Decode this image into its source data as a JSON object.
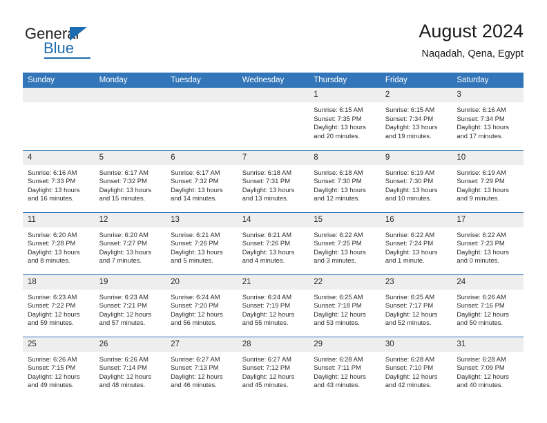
{
  "logo": {
    "name_top": "General",
    "name_bottom": "Blue",
    "accent_color": "#1b6cb0",
    "icon": "triangle-icon"
  },
  "header": {
    "title": "August 2024",
    "location": "Naqadah, Qena, Egypt"
  },
  "theme": {
    "header_blue": "#3275b8",
    "daynum_gray": "#eeeeee",
    "text": "#2b2b2b"
  },
  "calendar": {
    "weekday_headers": [
      "Sunday",
      "Monday",
      "Tuesday",
      "Wednesday",
      "Thursday",
      "Friday",
      "Saturday"
    ],
    "weeks": [
      [
        {
          "empty": true
        },
        {
          "empty": true
        },
        {
          "empty": true
        },
        {
          "empty": true
        },
        {
          "day": "1",
          "sunrise": "Sunrise: 6:15 AM",
          "sunset": "Sunset: 7:35 PM",
          "daylight": "Daylight: 13 hours and 20 minutes."
        },
        {
          "day": "2",
          "sunrise": "Sunrise: 6:15 AM",
          "sunset": "Sunset: 7:34 PM",
          "daylight": "Daylight: 13 hours and 19 minutes."
        },
        {
          "day": "3",
          "sunrise": "Sunrise: 6:16 AM",
          "sunset": "Sunset: 7:34 PM",
          "daylight": "Daylight: 13 hours and 17 minutes."
        }
      ],
      [
        {
          "day": "4",
          "sunrise": "Sunrise: 6:16 AM",
          "sunset": "Sunset: 7:33 PM",
          "daylight": "Daylight: 13 hours and 16 minutes."
        },
        {
          "day": "5",
          "sunrise": "Sunrise: 6:17 AM",
          "sunset": "Sunset: 7:32 PM",
          "daylight": "Daylight: 13 hours and 15 minutes."
        },
        {
          "day": "6",
          "sunrise": "Sunrise: 6:17 AM",
          "sunset": "Sunset: 7:32 PM",
          "daylight": "Daylight: 13 hours and 14 minutes."
        },
        {
          "day": "7",
          "sunrise": "Sunrise: 6:18 AM",
          "sunset": "Sunset: 7:31 PM",
          "daylight": "Daylight: 13 hours and 13 minutes."
        },
        {
          "day": "8",
          "sunrise": "Sunrise: 6:18 AM",
          "sunset": "Sunset: 7:30 PM",
          "daylight": "Daylight: 13 hours and 12 minutes."
        },
        {
          "day": "9",
          "sunrise": "Sunrise: 6:19 AM",
          "sunset": "Sunset: 7:30 PM",
          "daylight": "Daylight: 13 hours and 10 minutes."
        },
        {
          "day": "10",
          "sunrise": "Sunrise: 6:19 AM",
          "sunset": "Sunset: 7:29 PM",
          "daylight": "Daylight: 13 hours and 9 minutes."
        }
      ],
      [
        {
          "day": "11",
          "sunrise": "Sunrise: 6:20 AM",
          "sunset": "Sunset: 7:28 PM",
          "daylight": "Daylight: 13 hours and 8 minutes."
        },
        {
          "day": "12",
          "sunrise": "Sunrise: 6:20 AM",
          "sunset": "Sunset: 7:27 PM",
          "daylight": "Daylight: 13 hours and 7 minutes."
        },
        {
          "day": "13",
          "sunrise": "Sunrise: 6:21 AM",
          "sunset": "Sunset: 7:26 PM",
          "daylight": "Daylight: 13 hours and 5 minutes."
        },
        {
          "day": "14",
          "sunrise": "Sunrise: 6:21 AM",
          "sunset": "Sunset: 7:26 PM",
          "daylight": "Daylight: 13 hours and 4 minutes."
        },
        {
          "day": "15",
          "sunrise": "Sunrise: 6:22 AM",
          "sunset": "Sunset: 7:25 PM",
          "daylight": "Daylight: 13 hours and 3 minutes."
        },
        {
          "day": "16",
          "sunrise": "Sunrise: 6:22 AM",
          "sunset": "Sunset: 7:24 PM",
          "daylight": "Daylight: 13 hours and 1 minute."
        },
        {
          "day": "17",
          "sunrise": "Sunrise: 6:22 AM",
          "sunset": "Sunset: 7:23 PM",
          "daylight": "Daylight: 13 hours and 0 minutes."
        }
      ],
      [
        {
          "day": "18",
          "sunrise": "Sunrise: 6:23 AM",
          "sunset": "Sunset: 7:22 PM",
          "daylight": "Daylight: 12 hours and 59 minutes."
        },
        {
          "day": "19",
          "sunrise": "Sunrise: 6:23 AM",
          "sunset": "Sunset: 7:21 PM",
          "daylight": "Daylight: 12 hours and 57 minutes."
        },
        {
          "day": "20",
          "sunrise": "Sunrise: 6:24 AM",
          "sunset": "Sunset: 7:20 PM",
          "daylight": "Daylight: 12 hours and 56 minutes."
        },
        {
          "day": "21",
          "sunrise": "Sunrise: 6:24 AM",
          "sunset": "Sunset: 7:19 PM",
          "daylight": "Daylight: 12 hours and 55 minutes."
        },
        {
          "day": "22",
          "sunrise": "Sunrise: 6:25 AM",
          "sunset": "Sunset: 7:18 PM",
          "daylight": "Daylight: 12 hours and 53 minutes."
        },
        {
          "day": "23",
          "sunrise": "Sunrise: 6:25 AM",
          "sunset": "Sunset: 7:17 PM",
          "daylight": "Daylight: 12 hours and 52 minutes."
        },
        {
          "day": "24",
          "sunrise": "Sunrise: 6:26 AM",
          "sunset": "Sunset: 7:16 PM",
          "daylight": "Daylight: 12 hours and 50 minutes."
        }
      ],
      [
        {
          "day": "25",
          "sunrise": "Sunrise: 6:26 AM",
          "sunset": "Sunset: 7:15 PM",
          "daylight": "Daylight: 12 hours and 49 minutes."
        },
        {
          "day": "26",
          "sunrise": "Sunrise: 6:26 AM",
          "sunset": "Sunset: 7:14 PM",
          "daylight": "Daylight: 12 hours and 48 minutes."
        },
        {
          "day": "27",
          "sunrise": "Sunrise: 6:27 AM",
          "sunset": "Sunset: 7:13 PM",
          "daylight": "Daylight: 12 hours and 46 minutes."
        },
        {
          "day": "28",
          "sunrise": "Sunrise: 6:27 AM",
          "sunset": "Sunset: 7:12 PM",
          "daylight": "Daylight: 12 hours and 45 minutes."
        },
        {
          "day": "29",
          "sunrise": "Sunrise: 6:28 AM",
          "sunset": "Sunset: 7:11 PM",
          "daylight": "Daylight: 12 hours and 43 minutes."
        },
        {
          "day": "30",
          "sunrise": "Sunrise: 6:28 AM",
          "sunset": "Sunset: 7:10 PM",
          "daylight": "Daylight: 12 hours and 42 minutes."
        },
        {
          "day": "31",
          "sunrise": "Sunrise: 6:28 AM",
          "sunset": "Sunset: 7:09 PM",
          "daylight": "Daylight: 12 hours and 40 minutes."
        }
      ]
    ]
  }
}
